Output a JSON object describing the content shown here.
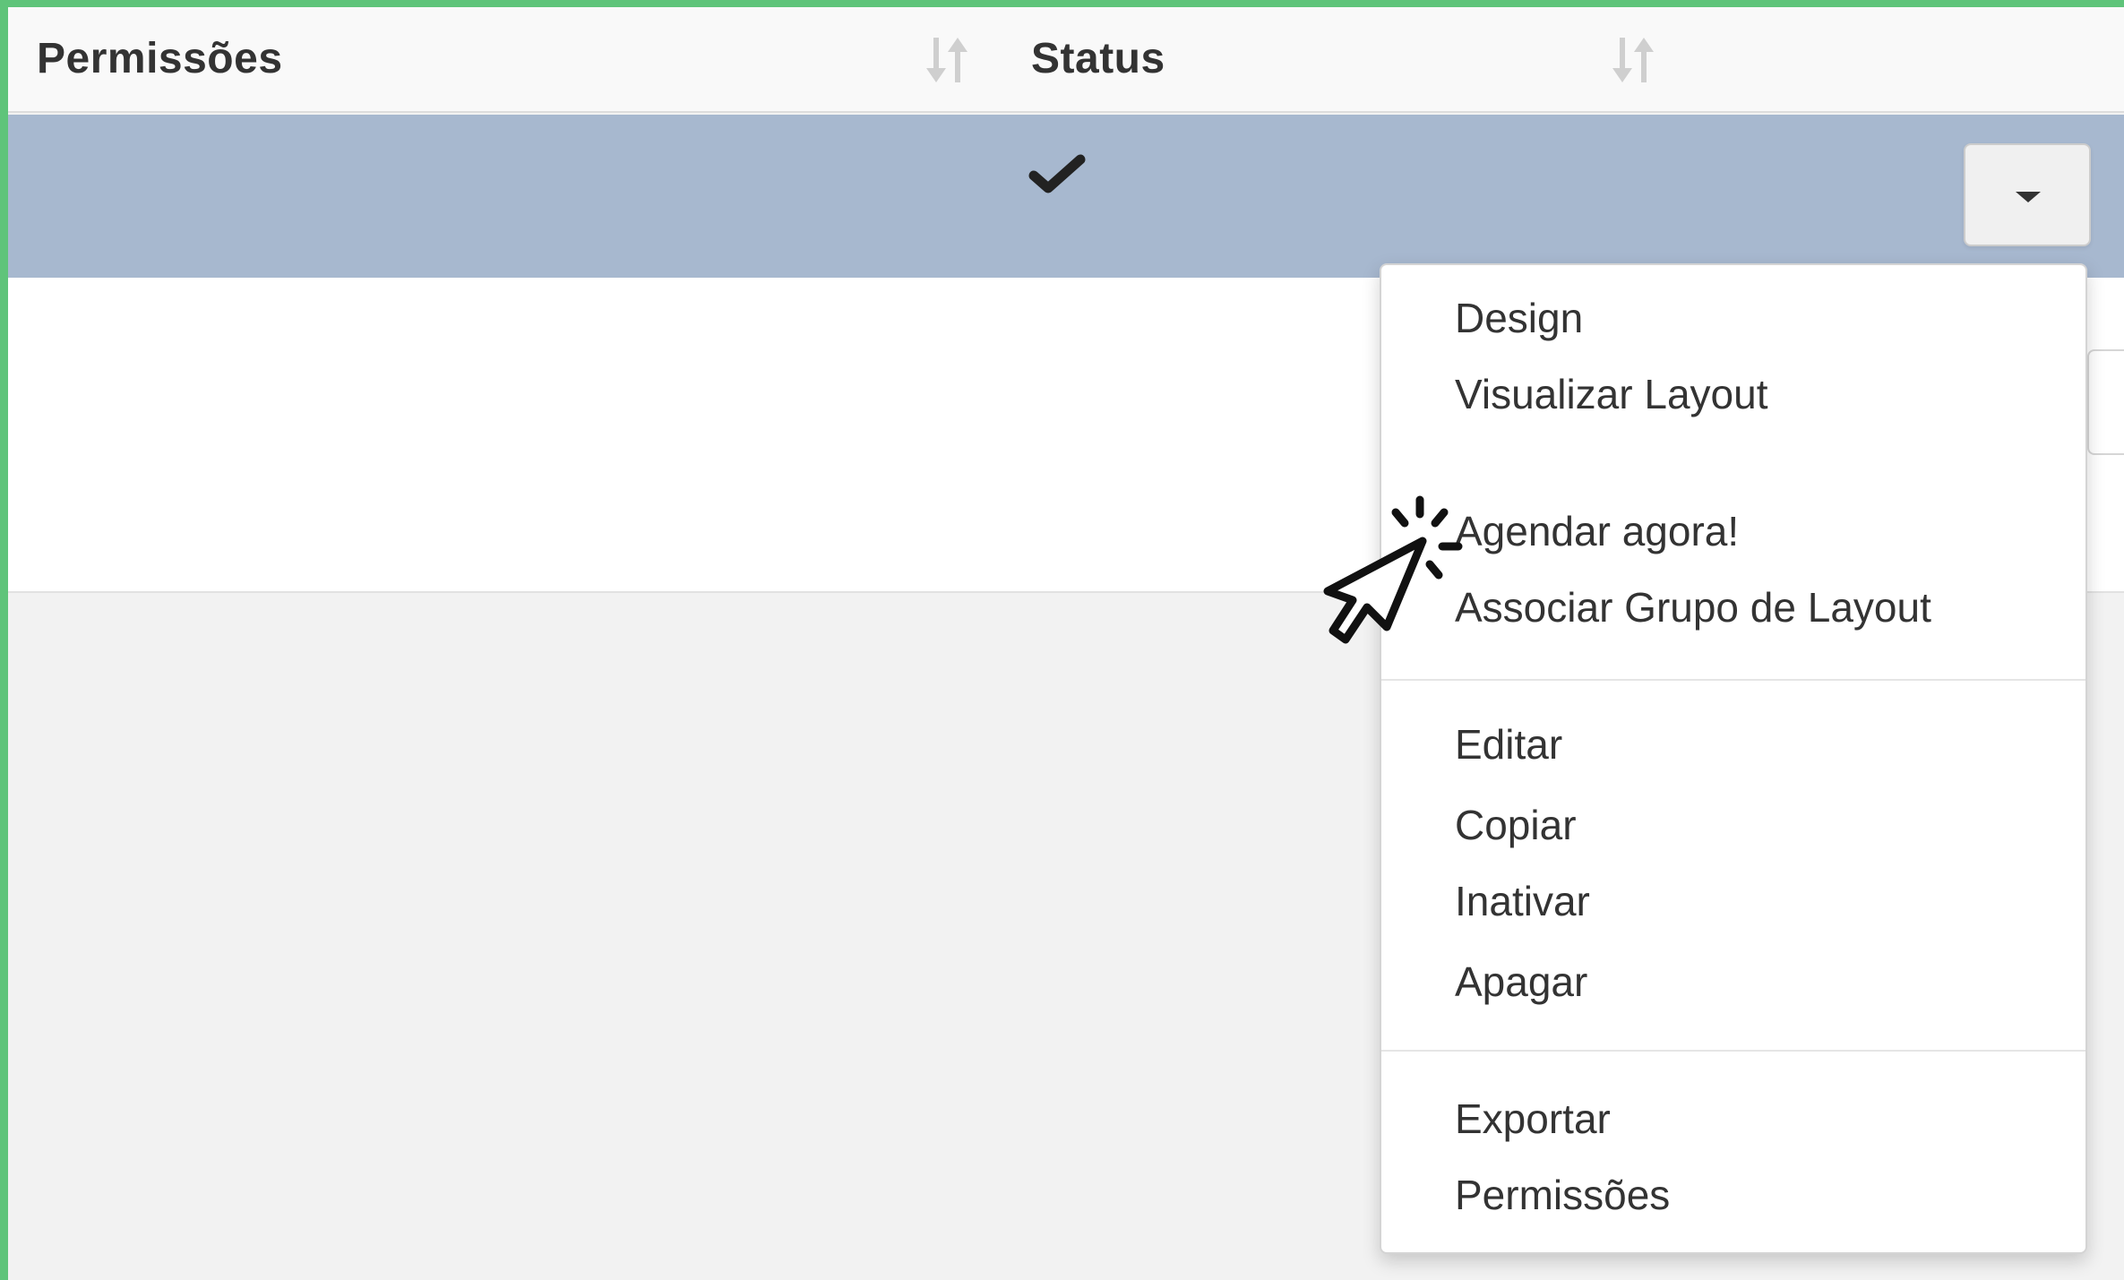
{
  "table": {
    "columns": [
      {
        "label": "Permissões",
        "sort_icon": "sort-both-icon"
      },
      {
        "label": "Status",
        "sort_icon": "sort-both-icon"
      }
    ],
    "selected_row": {
      "status_icon": "checkmark-icon",
      "actions_icon": "caret-down-icon"
    }
  },
  "dropdown_menu": {
    "groups": [
      [
        "Design",
        "Visualizar Layout"
      ],
      [
        "Agendar agora!",
        "Associar Grupo de Layout"
      ],
      [
        "Editar",
        "Copiar",
        "Inativar",
        "Apagar"
      ],
      [
        "Exportar",
        "Permissões"
      ]
    ]
  },
  "colors": {
    "frame_border": "#5fc47a",
    "selected_row_bg": "#a7b8cf",
    "menu_text": "#333333"
  }
}
